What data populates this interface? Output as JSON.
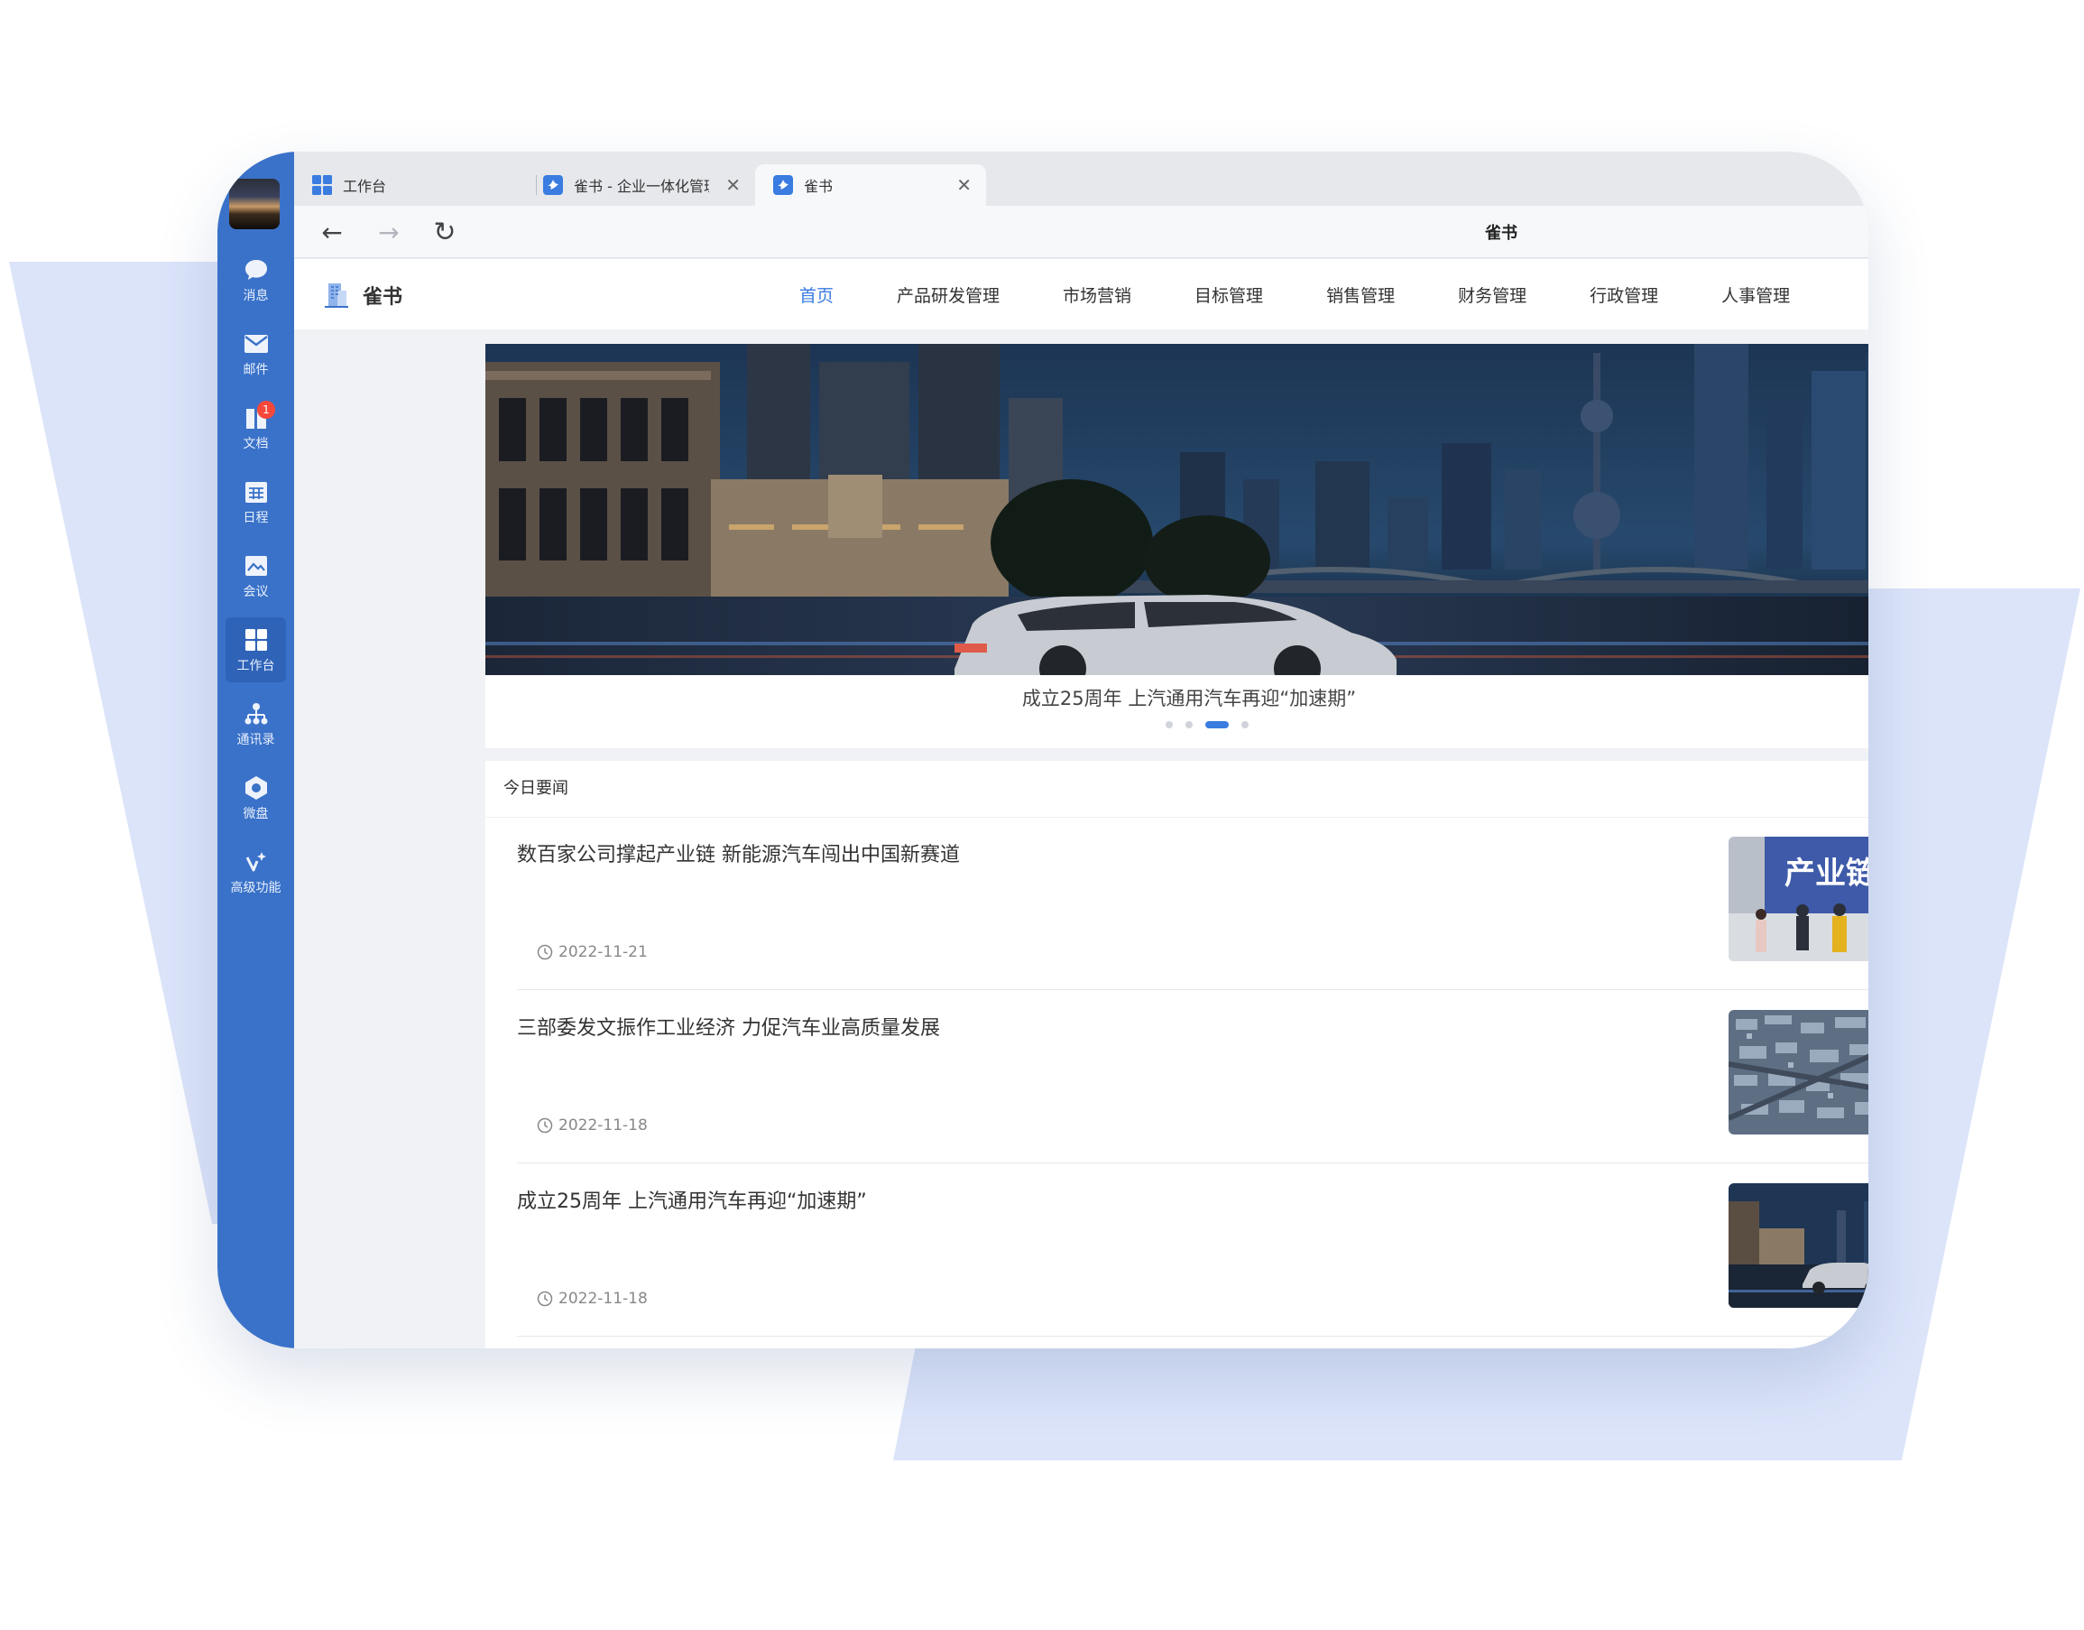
{
  "rail": {
    "items": [
      {
        "label": "消息",
        "icon": "chat-bubble-icon"
      },
      {
        "label": "邮件",
        "icon": "mail-icon"
      },
      {
        "label": "文档",
        "icon": "document-icon",
        "badge": "1"
      },
      {
        "label": "日程",
        "icon": "calendar-icon"
      },
      {
        "label": "会议",
        "icon": "meeting-icon"
      },
      {
        "label": "工作台",
        "icon": "workbench-icon",
        "active": true
      },
      {
        "label": "通讯录",
        "icon": "contacts-icon"
      },
      {
        "label": "微盘",
        "icon": "cloud-drive-icon"
      },
      {
        "label": "高级功能",
        "icon": "sparkle-icon"
      }
    ]
  },
  "browser": {
    "tabs": [
      {
        "label": "工作台",
        "icon": "workbench-grid-icon"
      },
      {
        "label": "雀书 - 企业一体化管理",
        "icon": "app-logo-icon",
        "closable": true
      },
      {
        "label": "雀书",
        "icon": "app-logo-icon",
        "closable": true,
        "active": true
      }
    ],
    "nav": {
      "back": "←",
      "forward": "→",
      "reload": "↻"
    },
    "page_title": "雀书"
  },
  "site": {
    "logo_text": "雀书",
    "menu": [
      "首页",
      "产品研发管理",
      "市场营销",
      "目标管理",
      "销售管理",
      "财务管理",
      "行政管理",
      "人事管理"
    ],
    "active_menu": "首页"
  },
  "hero": {
    "caption": "成立25周年 上汽通用汽车再迎“加速期”",
    "slide_count": 4,
    "active_slide": 3
  },
  "news": {
    "heading": "今日要闻",
    "items": [
      {
        "title": "数百家公司撑起产业链 新能源汽车闯出中国新赛道",
        "date": "2022-11-21",
        "thumb_text": "产业链"
      },
      {
        "title": "三部委发文振作工业经济 力促汽车业高质量发展",
        "date": "2022-11-18",
        "thumb_text": ""
      },
      {
        "title": "成立25周年 上汽通用汽车再迎“加速期”",
        "date": "2022-11-18",
        "thumb_text": ""
      }
    ]
  },
  "colors": {
    "accent": "#3a7ce0",
    "rail": "#3a72c9",
    "deco": "#dbe4f9",
    "badge": "#f5483b"
  }
}
